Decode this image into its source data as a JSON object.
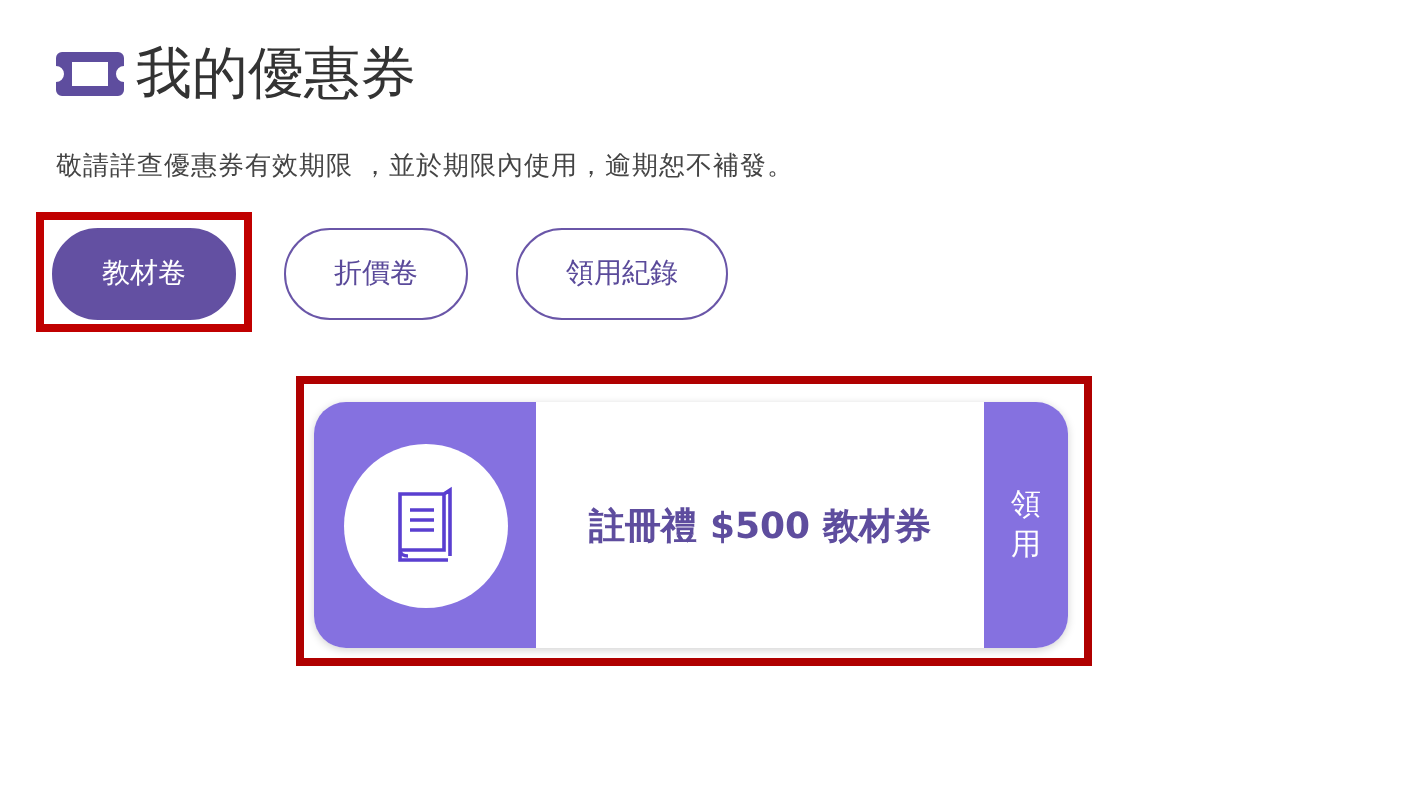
{
  "header": {
    "title": "我的優惠券"
  },
  "notice": "敬請詳查優惠券有效期限 ，並於期限內使用，逾期恕不補發。",
  "tabs": [
    {
      "label": "教材卷",
      "selected": true,
      "highlighted": true
    },
    {
      "label": "折價卷",
      "selected": false,
      "highlighted": false
    },
    {
      "label": "領用紀錄",
      "selected": false,
      "highlighted": false
    }
  ],
  "coupons": [
    {
      "title": "註冊禮 $500 教材券",
      "action": "領用",
      "highlighted": true
    }
  ]
}
